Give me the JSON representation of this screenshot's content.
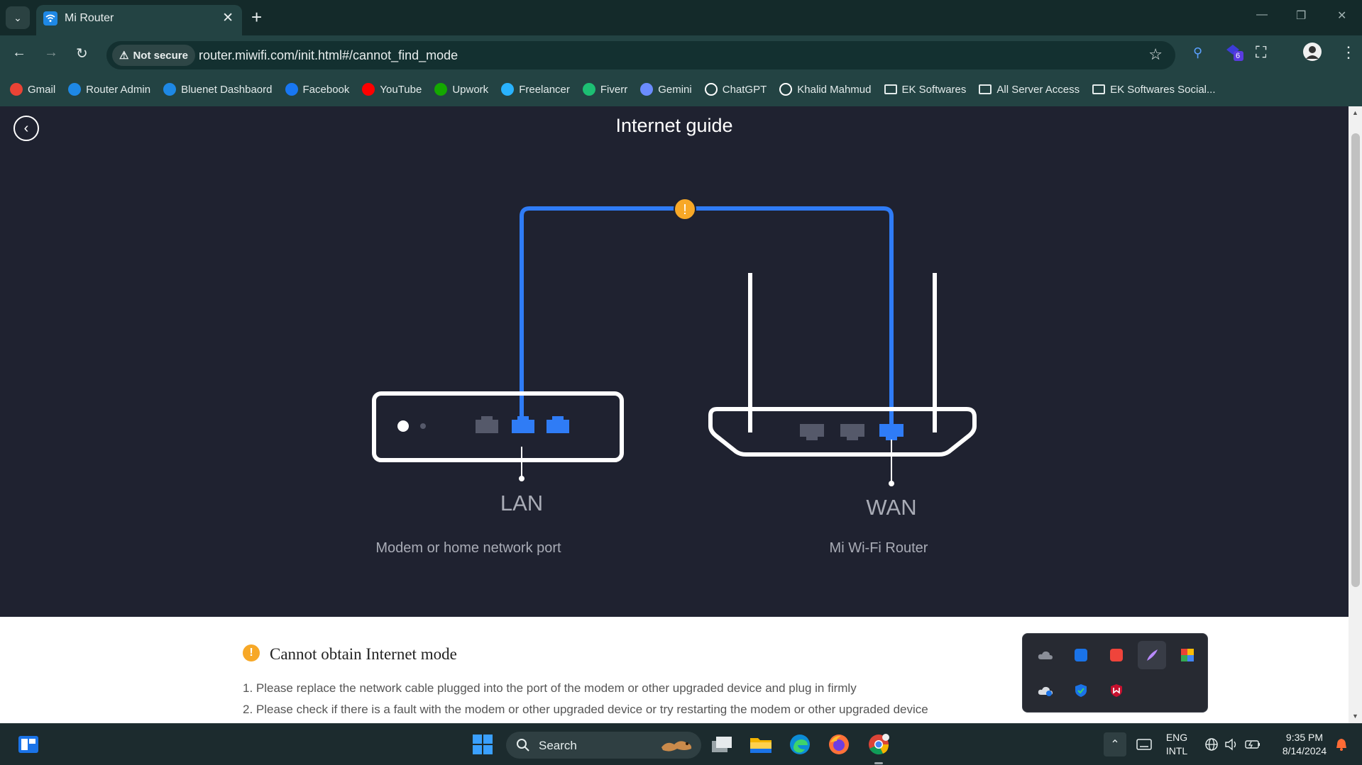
{
  "browser": {
    "tab": {
      "title": "Mi Router"
    },
    "address": {
      "security_label": "Not secure",
      "url": "router.miwifi.com/init.html#/cannot_find_mode"
    },
    "extension_badge": "6",
    "bookmarks": [
      {
        "label": "Gmail",
        "icon": "gmail-icon",
        "color": "#ea4335"
      },
      {
        "label": "Router Admin",
        "icon": "wifi-icon",
        "color": "#1e88e5"
      },
      {
        "label": "Bluenet Dashbaord",
        "icon": "wifi-icon",
        "color": "#1e88e5"
      },
      {
        "label": "Facebook",
        "icon": "facebook-icon",
        "color": "#1877f2"
      },
      {
        "label": "YouTube",
        "icon": "youtube-icon",
        "color": "#ff0000"
      },
      {
        "label": "Upwork",
        "icon": "upwork-icon",
        "color": "#14a800"
      },
      {
        "label": "Freelancer",
        "icon": "freelancer-icon",
        "color": "#29b2fe"
      },
      {
        "label": "Fiverr",
        "icon": "fiverr-icon",
        "color": "#1dbf73"
      },
      {
        "label": "Gemini",
        "icon": "gemini-icon",
        "color": "#6b8cff"
      },
      {
        "label": "ChatGPT",
        "icon": "chatgpt-icon",
        "color": "#ffffff"
      },
      {
        "label": "Khalid Mahmud",
        "icon": "github-icon",
        "color": "#ffffff"
      },
      {
        "label": "EK Softwares",
        "icon": "folder-icon"
      },
      {
        "label": "All Server Access",
        "icon": "folder-icon"
      },
      {
        "label": "EK Softwares Social...",
        "icon": "folder-icon"
      }
    ]
  },
  "page": {
    "title": "Internet guide",
    "diagram": {
      "lan_label": "LAN",
      "wan_label": "WAN",
      "modem_caption": "Modem or home network port",
      "router_caption": "Mi Wi-Fi Router",
      "warning_mark": "!",
      "cable_color": "#2f7cf6",
      "warning_color": "#f7a827"
    },
    "error": {
      "title": "Cannot obtain Internet mode",
      "steps": [
        "1. Please replace the network cable plugged into the port of the modem or other upgraded device and plug in firmly",
        "2. Please check if there is a fault with the modem or other upgraded device or try restarting the modem or other upgraded device"
      ]
    }
  },
  "taskbar": {
    "search_label": "Search",
    "language_top": "ENG",
    "language_bottom": "INTL",
    "time": "9:35 PM",
    "date": "8/14/2024"
  }
}
